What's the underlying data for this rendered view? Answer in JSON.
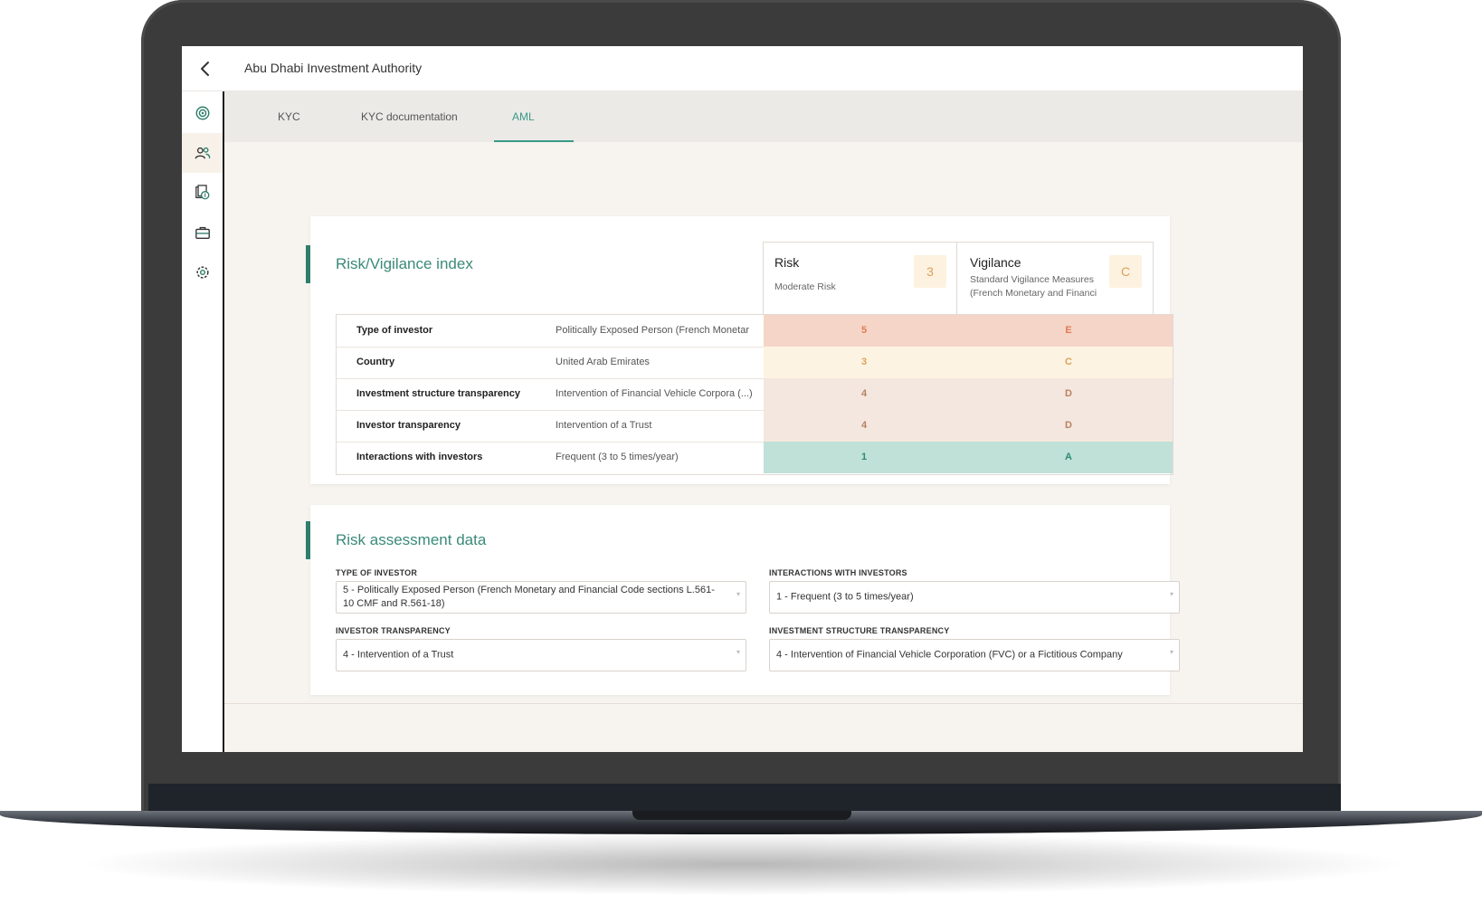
{
  "header": {
    "title": "Abu Dhabi Investment Authority"
  },
  "sidebar": {
    "items": [
      {
        "icon": "target-icon"
      },
      {
        "icon": "users-icon",
        "active": true
      },
      {
        "icon": "money-documents-icon"
      },
      {
        "icon": "briefcase-icon"
      },
      {
        "icon": "gear-icon"
      }
    ]
  },
  "tabs": [
    {
      "label": "KYC"
    },
    {
      "label": "KYC documentation"
    },
    {
      "label": "AML",
      "active": true
    }
  ],
  "risk_index": {
    "title": "Risk/Vigilance index",
    "risk": {
      "title": "Risk",
      "subtitle": "Moderate Risk",
      "badge": "3"
    },
    "vigilance": {
      "title": "Vigilance",
      "subtitle_line1": "Standard Vigilance Measures",
      "subtitle_line2": "(French Monetary and Financi",
      "badge": "C"
    },
    "rows": [
      {
        "label": "Type of investor",
        "value": "Politically Exposed Person (French Monetar",
        "risk": "5",
        "vigilance": "E",
        "bg": "#f5d5c8",
        "fg": "#e07a55"
      },
      {
        "label": "Country",
        "value": "United Arab Emirates",
        "risk": "3",
        "vigilance": "C",
        "bg": "#fdf3e3",
        "fg": "#d9a35a"
      },
      {
        "label": "Investment structure transparency",
        "value": "Intervention of Financial Vehicle Corpora (...)",
        "risk": "4",
        "vigilance": "D",
        "bg": "#f4e7df",
        "fg": "#b9825f"
      },
      {
        "label": "Investor transparency",
        "value": "Intervention of a Trust",
        "risk": "4",
        "vigilance": "D",
        "bg": "#f4e7df",
        "fg": "#b9825f"
      },
      {
        "label": "Interactions with investors",
        "value": "Frequent (3 to 5 times/year)",
        "risk": "1",
        "vigilance": "A",
        "bg": "#bfe1d8",
        "fg": "#2e8a74"
      }
    ]
  },
  "assessment": {
    "title": "Risk assessment data",
    "fields": {
      "type_of_investor": {
        "label": "TYPE OF INVESTOR",
        "value": "5 - Politically Exposed Person (French Monetary and Financial Code sections L.561-10 CMF and R.561-18)"
      },
      "interactions": {
        "label": "INTERACTIONS WITH INVESTORS",
        "value": "1 - Frequent (3 to 5 times/year)"
      },
      "investor_transparency": {
        "label": "INVESTOR TRANSPARENCY",
        "value": "4 - Intervention of a Trust"
      },
      "structure_transparency": {
        "label": "INVESTMENT STRUCTURE TRANSPARENCY",
        "value": "4 - Intervention of Financial Vehicle Corporation (FVC) or a Fictitious Company"
      }
    }
  },
  "colors": {
    "accent": "#3a9a88",
    "accent_dark": "#2f7e6b"
  }
}
